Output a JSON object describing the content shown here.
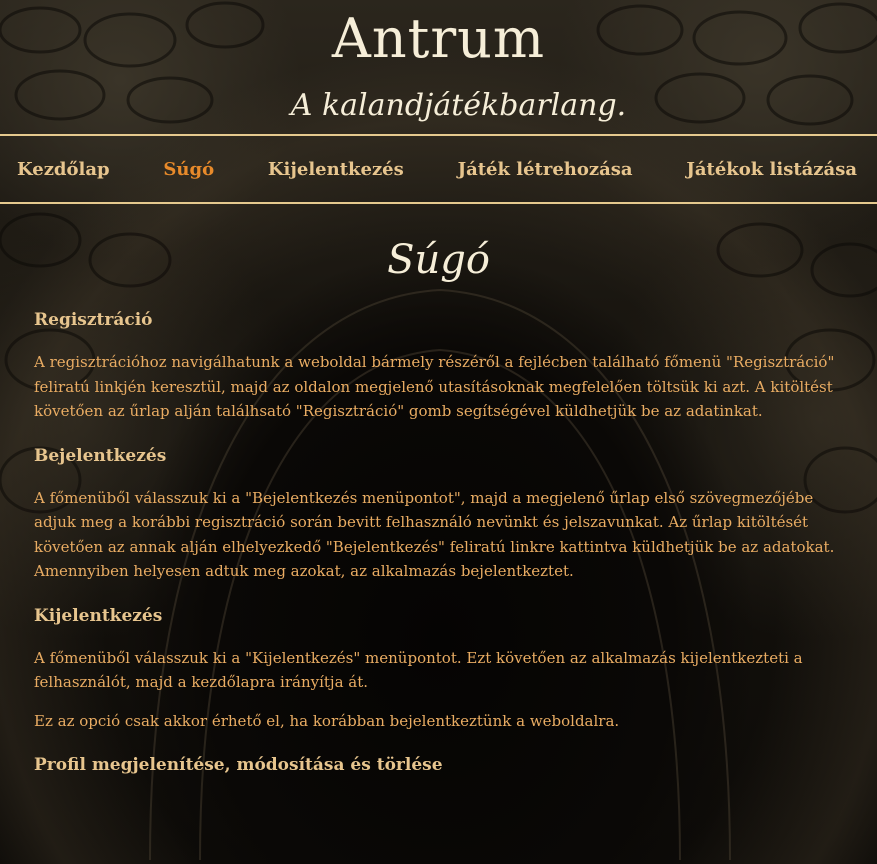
{
  "header": {
    "title": "Antrum",
    "subtitle": "A kalandjátékbarlang."
  },
  "nav": {
    "items": [
      {
        "label": "Kezdőlap",
        "active": false
      },
      {
        "label": "Súgó",
        "active": true
      },
      {
        "label": "Kijelentkezés",
        "active": false
      },
      {
        "label": "Játék létrehozása",
        "active": false
      },
      {
        "label": "Játékok listázása",
        "active": false
      }
    ]
  },
  "main": {
    "title": "Súgó",
    "sections": [
      {
        "heading": "Regisztráció",
        "paragraphs": [
          "A regisztrációhoz navigálhatunk a weboldal bármely részéről a fejlécben található főmenü \"Regisztráció\" feliratú linkjén keresztül, majd az oldalon megjelenő utasításoknak megfelelően töltsük ki azt. A kitöltést követően az űrlap alján találhsató \"Regisztráció\" gomb segítségével küldhetjük be az adatinkat."
        ]
      },
      {
        "heading": "Bejelentkezés",
        "paragraphs": [
          "A főmenüből válasszuk ki a \"Bejelentkezés menüpontot\", majd a megjelenő űrlap első szövegmezőjébe adjuk meg a korábbi regisztráció során bevitt felhasználó nevünkt és jelszavunkat. Az űrlap kitöltését követően az annak alján elhelyezkedő \"Bejelentkezés\" feliratú linkre kattintva küldhetjük be az adatokat. Amennyiben helyesen adtuk meg azokat, az alkalmazás bejelentkeztet."
        ]
      },
      {
        "heading": "Kijelentkezés",
        "paragraphs": [
          "A főmenüből válasszuk ki a \"Kijelentkezés\" menüpontot. Ezt követően az alkalmazás kijelentkezteti a felhasználót, majd a kezdőlapra irányítja át.",
          "Ez az opció csak akkor érhető el, ha korábban bejelentkeztünk a weboldalra."
        ]
      },
      {
        "heading": "Profil megjelenítése, módosítása és törlése",
        "paragraphs": []
      }
    ]
  }
}
